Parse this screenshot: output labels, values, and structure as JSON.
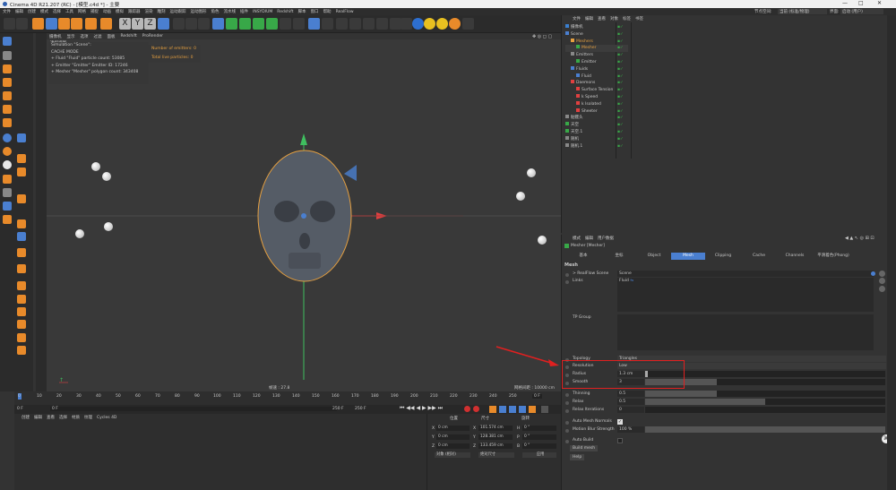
{
  "window": {
    "title": "Cinema 4D R21.207 (RC) - [模型.c4d *] - 主要",
    "controls": [
      "—",
      "□",
      "✕"
    ]
  },
  "menubar": {
    "items": [
      "文件",
      "编辑",
      "创建",
      "模式",
      "选择",
      "工具",
      "网格",
      "捕捉",
      "动画",
      "模拟",
      "跟踪器",
      "渲染",
      "雕刻",
      "运动跟踪",
      "运动图形",
      "角色",
      "流水线",
      "插件",
      "INSYDIUM",
      "Redshift",
      "脚本",
      "窗口",
      "帮助",
      "RealFlow"
    ],
    "node_space_label": "节点空间:",
    "node_space_value": "当前 (标准/物理)",
    "layout_label": "界面:",
    "layout_value": "启动 (用户)"
  },
  "viewport": {
    "menu": [
      "摄像机",
      "显示",
      "选项",
      "过滤",
      "面板",
      "Redshift",
      "ProRender"
    ],
    "camera_label": "透视视图",
    "stats": [
      "Simulation \"Scene\":",
      "CACHE MODE",
      "+ Fluid \"Fluid\" particle count: 53085",
      "+ Emitter \"Emitter\" Emitter ID: 17246",
      "+ Mesher \"Mesher\" polygon count: 343408"
    ],
    "emitters": [
      "Number of emitters: 0",
      "Total live particles: 0"
    ],
    "speed": "帧速 : 27.8",
    "grid": "网格间距 : 10000 cm"
  },
  "timeline": {
    "ticks": [
      "0",
      "10",
      "20",
      "30",
      "40",
      "50",
      "60",
      "70",
      "80",
      "90",
      "100",
      "110",
      "120",
      "130",
      "140",
      "150",
      "160",
      "170",
      "180",
      "190",
      "200",
      "210",
      "220",
      "230",
      "240",
      "250"
    ],
    "current_frame": "0 F",
    "start": "0 F",
    "start2": "0 F",
    "end": "250 F",
    "end2": "250 F"
  },
  "material": {
    "menu": [
      "创建",
      "编辑",
      "查看",
      "选择",
      "材质",
      "纹理",
      "Cycles 4D"
    ]
  },
  "coords": {
    "headers": [
      "位置",
      "尺寸",
      "旋转"
    ],
    "rows": [
      {
        "axis": "X",
        "pos": "0 cm",
        "size": "101.574 cm",
        "rlabel": "H",
        "rot": "0 °"
      },
      {
        "axis": "Y",
        "pos": "0 cm",
        "size": "128.381 cm",
        "rlabel": "P",
        "rot": "0 °"
      },
      {
        "axis": "Z",
        "pos": "0 cm",
        "size": "133.459 cm",
        "rlabel": "B",
        "rot": "0 °"
      }
    ],
    "mode": "对象 (相对)",
    "size_mode": "绝对尺寸",
    "apply": "应用"
  },
  "objects": {
    "menu": [
      "文件",
      "编辑",
      "查看",
      "对象",
      "标签",
      "书签"
    ],
    "rows": [
      {
        "name": "摄像机",
        "indent": 0
      },
      {
        "name": "Scene",
        "indent": 0
      },
      {
        "name": "Meshers",
        "indent": 1
      },
      {
        "name": "Mesher",
        "indent": 2
      },
      {
        "name": "Emitters",
        "indent": 1
      },
      {
        "name": "Emitter",
        "indent": 2
      },
      {
        "name": "Fluids",
        "indent": 1
      },
      {
        "name": "Fluid",
        "indent": 2
      },
      {
        "name": "Daemons",
        "indent": 1
      },
      {
        "name": "Surface Tension",
        "indent": 2
      },
      {
        "name": "k Speed",
        "indent": 2
      },
      {
        "name": "k Isolated",
        "indent": 2
      },
      {
        "name": "Sheeter",
        "indent": 2
      },
      {
        "name": "骷髅头",
        "indent": 0
      },
      {
        "name": "天空",
        "indent": 0
      },
      {
        "name": "天空.1",
        "indent": 0
      },
      {
        "name": "随机",
        "indent": 0
      },
      {
        "name": "随机.1",
        "indent": 0
      }
    ]
  },
  "attributes": {
    "menu": [
      "模式",
      "编辑",
      "用户数据"
    ],
    "object_title": "Mesher [Mesher]",
    "tabs": [
      "基本",
      "坐标",
      "Object",
      "Mesh",
      "Clipping",
      "Cache",
      "Channels",
      "平滑着色(Phong)"
    ],
    "section": "Mesh",
    "realflow_scene_label": "> RealFlow Scene",
    "realflow_scene_value": "Scene",
    "links_label": "Links",
    "links_value": "Fluid",
    "tp_group_label": "TP Group",
    "topology_label": "Topology",
    "topology_value": "Triangles",
    "resolution_label": "Resolution",
    "resolution_value": "Low",
    "radius_label": "Radius",
    "radius_value": "1.3 cm",
    "smooth_label": "Smooth",
    "smooth_value": "3",
    "thinning_label": "Thinning",
    "thinning_value": "0.5",
    "relax_label": "Relax",
    "relax_value": "0.5",
    "relax_iter_label": "Relax Iterations",
    "relax_iter_value": "0",
    "auto_normals_label": "Auto Mesh Normals",
    "motion_blur_label": "Motion Blur Strength",
    "motion_blur_value": "100 %",
    "auto_build_label": "Auto Build",
    "build_mesh": "Build mesh",
    "help": "Help"
  },
  "colors": {
    "accent": "#4a7fd0",
    "highlight": "#e6a040",
    "annotation": "#e02020"
  }
}
